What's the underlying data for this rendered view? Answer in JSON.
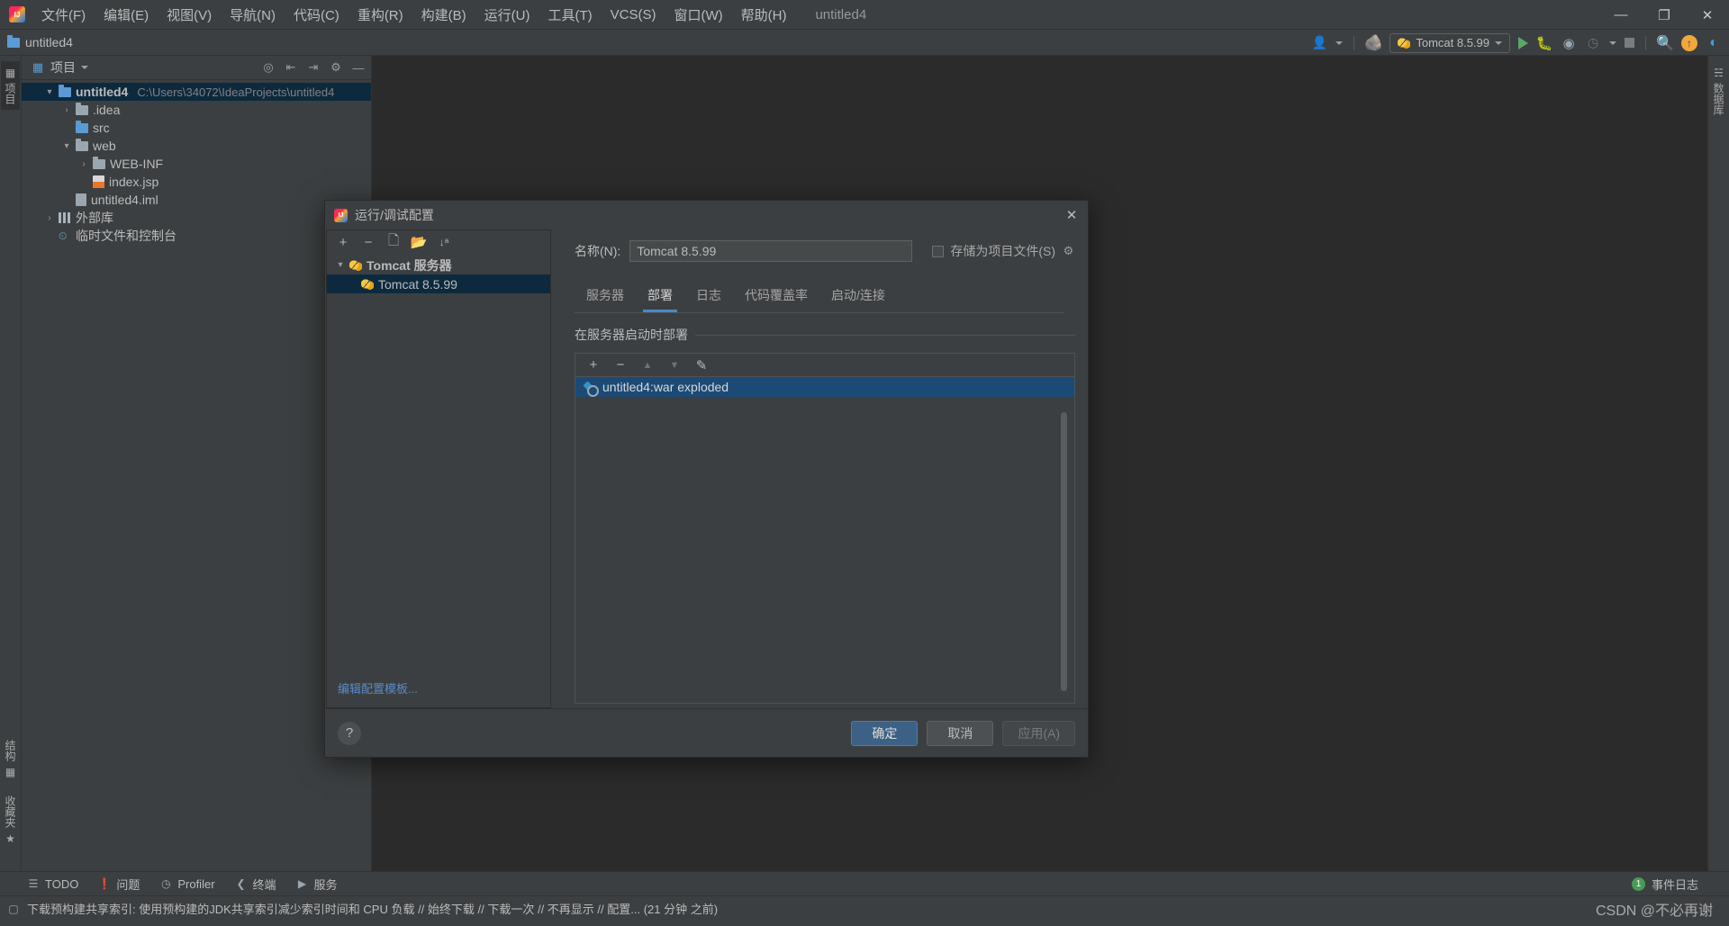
{
  "titlebar": {
    "logo_icon": "intellij-logo-icon",
    "menus": [
      "文件(F)",
      "编辑(E)",
      "视图(V)",
      "导航(N)",
      "代码(C)",
      "重构(R)",
      "构建(B)",
      "运行(U)",
      "工具(T)",
      "VCS(S)",
      "窗口(W)",
      "帮助(H)"
    ],
    "window_title": "untitled4",
    "minimize": "—",
    "maximize": "❐",
    "close": "✕"
  },
  "navbar": {
    "project_name": "untitled4",
    "toolbar": {
      "run_config_label": "Tomcat 8.5.99",
      "icons": [
        "user-avatar-icon",
        "build-hammer-icon",
        "run-icon",
        "debug-icon",
        "run-with-coverage-icon",
        "profiler-icon",
        "stop-icon",
        "search-everywhere-icon",
        "update-icon",
        "ide-feature-icon"
      ]
    }
  },
  "left_strip": {
    "tabs": [
      {
        "label": "项目",
        "icon": "project-tool-icon",
        "active": true
      },
      {
        "label": "结构",
        "icon": "structure-icon",
        "active": false
      },
      {
        "label": "收藏夹",
        "icon": "favorites-star-icon",
        "active": false
      }
    ]
  },
  "right_strip": {
    "tabs": [
      {
        "label": "数据库",
        "icon": "database-icon",
        "active": false
      }
    ]
  },
  "project_panel": {
    "header": {
      "title": "项目",
      "dropdown_icon": "chevron-down-icon",
      "icons": [
        "locate-icon",
        "expand-all-icon",
        "collapse-all-icon",
        "settings-gear-icon",
        "hide-icon"
      ]
    },
    "tree": [
      {
        "indent": 0,
        "chevron": "▾",
        "icon": "module-folder-icon",
        "name": "untitled4",
        "path": "C:\\Users\\34072\\IdeaProjects\\untitled4",
        "bold": true,
        "selected": true
      },
      {
        "indent": 1,
        "chevron": "›",
        "icon": "folder-icon",
        "name": ".idea",
        "path": "",
        "bold": false,
        "selected": false
      },
      {
        "indent": 1,
        "chevron": "",
        "icon": "source-folder-icon",
        "name": "src",
        "path": "",
        "bold": false,
        "selected": false
      },
      {
        "indent": 1,
        "chevron": "▾",
        "icon": "web-folder-icon",
        "name": "web",
        "path": "",
        "bold": false,
        "selected": false
      },
      {
        "indent": 2,
        "chevron": "›",
        "icon": "folder-icon",
        "name": "WEB-INF",
        "path": "",
        "bold": false,
        "selected": false
      },
      {
        "indent": 2,
        "chevron": "",
        "icon": "jsp-file-icon",
        "name": "index.jsp",
        "path": "",
        "bold": false,
        "selected": false
      },
      {
        "indent": 1,
        "chevron": "",
        "icon": "iml-file-icon",
        "name": "untitled4.iml",
        "path": "",
        "bold": false,
        "selected": false
      },
      {
        "indent": 0,
        "chevron": "›",
        "icon": "external-libraries-icon",
        "name": "外部库",
        "path": "",
        "bold": false,
        "selected": false
      },
      {
        "indent": 0,
        "chevron": "",
        "icon": "scratches-icon",
        "name": "临时文件和控制台",
        "path": "",
        "bold": false,
        "selected": false
      }
    ]
  },
  "dialog": {
    "title": "运行/调试配置",
    "title_icon": "intellij-logo-icon",
    "close_icon": "close-icon",
    "config_toolbar": [
      "add-icon",
      "remove-icon",
      "copy-icon",
      "save-config-icon",
      "sort-icon"
    ],
    "config_tree": [
      {
        "chevron": "▾",
        "icon": "tomcat-icon",
        "name": "Tomcat 服务器",
        "bold": true,
        "selected": false,
        "child": false
      },
      {
        "chevron": "",
        "icon": "tomcat-icon",
        "name": "Tomcat 8.5.99",
        "bold": false,
        "selected": true,
        "child": true
      }
    ],
    "edit_templates_link": "编辑配置模板...",
    "name_label": "名称(N):",
    "name_value": "Tomcat 8.5.99",
    "name_placeholder": "",
    "store_as_project_file_label": "存储为项目文件(S)",
    "store_as_project_file_checked": false,
    "store_gear_icon": "settings-gear-icon",
    "tabs": [
      {
        "label": "服务器",
        "active": false
      },
      {
        "label": "部署",
        "active": true
      },
      {
        "label": "日志",
        "active": false
      },
      {
        "label": "代码覆盖率",
        "active": false
      },
      {
        "label": "启动/连接",
        "active": false
      }
    ],
    "section_title": "在服务器启动时部署",
    "list_toolbar": [
      {
        "icon": "add-icon",
        "glyph": "+",
        "enabled": true
      },
      {
        "icon": "remove-icon",
        "glyph": "−",
        "enabled": true
      },
      {
        "icon": "move-up-icon",
        "glyph": "▲",
        "enabled": false
      },
      {
        "icon": "move-down-icon",
        "glyph": "▼",
        "enabled": false
      },
      {
        "icon": "edit-pencil-icon",
        "glyph": "✎",
        "enabled": true
      }
    ],
    "deploy_items": [
      {
        "icon": "artifact-icon",
        "label": "untitled4:war exploded",
        "selected": true
      }
    ],
    "footer": {
      "help_label": "?",
      "ok_label": "确定",
      "cancel_label": "取消",
      "apply_label": "应用(A)",
      "apply_enabled": false
    }
  },
  "toolwindow_bar": {
    "items": [
      {
        "label": "TODO",
        "icon": "todo-icon"
      },
      {
        "label": "问题",
        "icon": "problems-icon"
      },
      {
        "label": "Profiler",
        "icon": "profiler-icon"
      },
      {
        "label": "终端",
        "icon": "terminal-icon"
      },
      {
        "label": "服务",
        "icon": "services-icon"
      }
    ],
    "event_log_label": "事件日志",
    "event_log_count": "1"
  },
  "statusbar": {
    "icon": "notification-icon",
    "message": "下载预构建共享索引: 使用预构建的JDK共享索引减少索引时间和 CPU 负载 // 始终下载 // 下载一次 // 不再显示 // 配置... (21 分钟 之前)",
    "watermark": "CSDN @不必再谢"
  },
  "colors": {
    "accent_blue": "#4a88c7",
    "selection_blue": "#1b4a76",
    "tree_selection": "#0d293e",
    "panel_bg": "#3c3f41",
    "editor_bg": "#2b2b2b",
    "link_blue": "#5a8ac7",
    "green": "#499c54"
  }
}
